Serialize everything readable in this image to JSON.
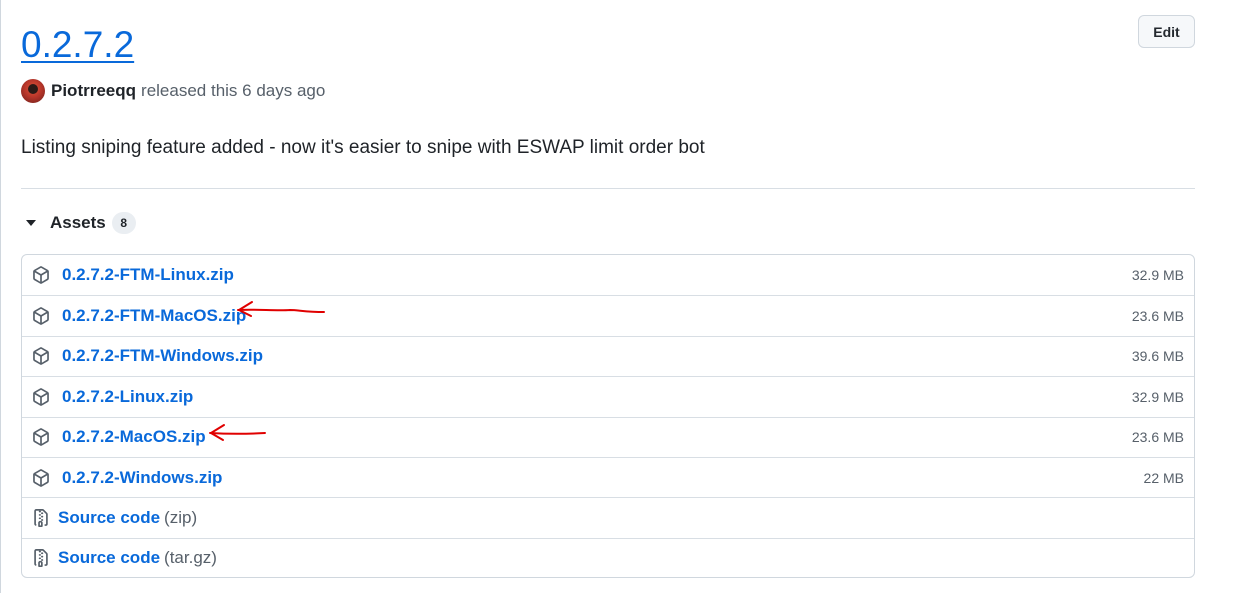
{
  "release": {
    "title": "0.2.7.2",
    "edit_label": "Edit",
    "author": "Piotrreeqq",
    "released_text": "released this 6 days ago",
    "description": "Listing sniping feature added - now it's easier to snipe with ESWAP limit order bot"
  },
  "assets": {
    "title": "Assets",
    "count": "8",
    "files": [
      {
        "name": "0.2.7.2-FTM-Linux.zip",
        "size": "32.9 MB",
        "icon": "package-icon"
      },
      {
        "name": "0.2.7.2-FTM-MacOS.zip",
        "size": "23.6 MB",
        "icon": "package-icon"
      },
      {
        "name": "0.2.7.2-FTM-Windows.zip",
        "size": "39.6 MB",
        "icon": "package-icon"
      },
      {
        "name": "0.2.7.2-Linux.zip",
        "size": "32.9 MB",
        "icon": "package-icon"
      },
      {
        "name": "0.2.7.2-MacOS.zip",
        "size": "23.6 MB",
        "icon": "package-icon"
      },
      {
        "name": "0.2.7.2-Windows.zip",
        "size": "22 MB",
        "icon": "package-icon"
      }
    ],
    "source": [
      {
        "label": "Source code",
        "ext": "(zip)",
        "icon": "file-zip-icon"
      },
      {
        "label": "Source code",
        "ext": "(tar.gz)",
        "icon": "file-zip-icon"
      }
    ]
  },
  "colors": {
    "link": "#0969da",
    "annotation": "#e00000"
  }
}
